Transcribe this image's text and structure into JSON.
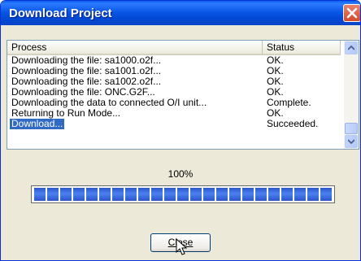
{
  "window": {
    "title": "Download Project"
  },
  "list": {
    "columns": {
      "process": "Process",
      "status": "Status"
    },
    "rows": [
      {
        "process": "Downloading the file: sa1000.o2f...",
        "status": "OK."
      },
      {
        "process": "Downloading the file: sa1001.o2f...",
        "status": "OK."
      },
      {
        "process": "Downloading the file: sa1002.o2f...",
        "status": "OK."
      },
      {
        "process": "Downloading the file: ONC.G2F...",
        "status": "OK."
      },
      {
        "process": "Downloading the data to connected O/I unit...",
        "status": "Complete."
      },
      {
        "process": "Returning to Run Mode...",
        "status": "OK."
      },
      {
        "process": "Download...",
        "status": "Succeeded.",
        "selected": true
      }
    ]
  },
  "progress": {
    "label": "100%",
    "value": 1.0,
    "segments": 23
  },
  "buttons": {
    "close": "Close"
  },
  "colors": {
    "titlebar": "#0A58E6",
    "selection": "#316AC5",
    "progress_fill": "#2A56C9",
    "dialog_bg": "#ECE9D8"
  },
  "icons": {
    "close": "close-icon",
    "scroll_up": "arrow-up-icon",
    "scroll_down": "arrow-down-icon",
    "cursor": "mouse-cursor-icon"
  }
}
